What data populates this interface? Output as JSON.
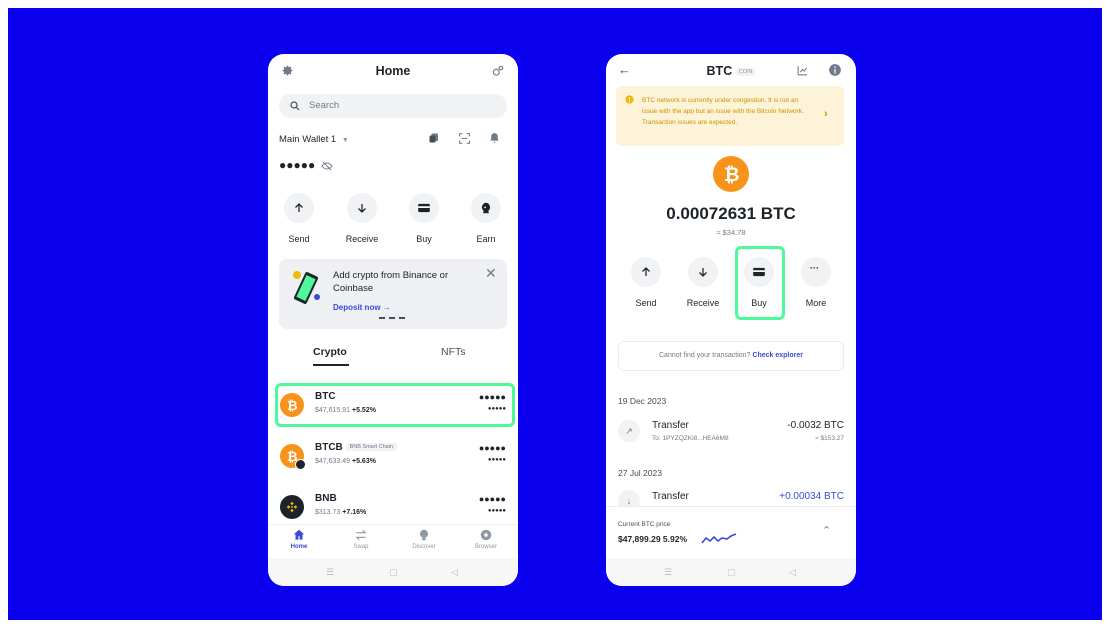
{
  "left_phone": {
    "title": "Home",
    "search_placeholder": "Search",
    "wallet_name": "Main Wallet 1",
    "hidden_balance": "●●●●●",
    "actions": [
      "Send",
      "Receive",
      "Buy",
      "Earn"
    ],
    "promo": {
      "text": "Add crypto from Binance or Coinbase",
      "link": "Deposit now →"
    },
    "tabs": [
      "Crypto",
      "NFTs"
    ],
    "assets": [
      {
        "symbol": "BTC",
        "price": "$47,615.91",
        "change": "+5.52%",
        "amount": "●●●●●",
        "fiat": "●●●●●"
      },
      {
        "symbol": "BTCB",
        "chain": "BNB Smart Chain",
        "price": "$47,633.49",
        "change": "+5.63%",
        "amount": "●●●●●",
        "fiat": "●●●●●"
      },
      {
        "symbol": "BNB",
        "price": "$313.73",
        "change": "+7.16%",
        "amount": "●●●●●",
        "fiat": "●●●●●"
      }
    ],
    "nav": [
      "Home",
      "Swap",
      "Discover",
      "Browser"
    ]
  },
  "right_phone": {
    "title": "BTC",
    "badge": "COIN",
    "banner": "BTC network is currently under congestion. It is not an issue with the app but an issue with the Bitcoin Network. Transaction issues are expected.",
    "balance": "0.00072631 BTC",
    "fiat": "≈ $34.78",
    "actions": [
      "Send",
      "Receive",
      "Buy",
      "More"
    ],
    "explorer_text": "Cannot find your transaction?",
    "explorer_link": "Check explorer",
    "transactions": [
      {
        "date": "19 Dec 2023",
        "type": "Transfer",
        "sub": "To: 1PYZQZKi8...HEA6M8",
        "amount": "-0.0032 BTC",
        "fiat": "≈ $153.27"
      },
      {
        "date": "27 Jul 2023",
        "type": "Transfer",
        "sub": "",
        "amount": "+0.00034 BTC",
        "fiat": ""
      }
    ],
    "price_label": "Current BTC price",
    "price_value": "$47,899.29 5.92%"
  },
  "colors": {
    "background": "#0a00ee",
    "highlight": "#4ef89b",
    "btc": "#f7931a",
    "accent": "#3a4bd6"
  }
}
